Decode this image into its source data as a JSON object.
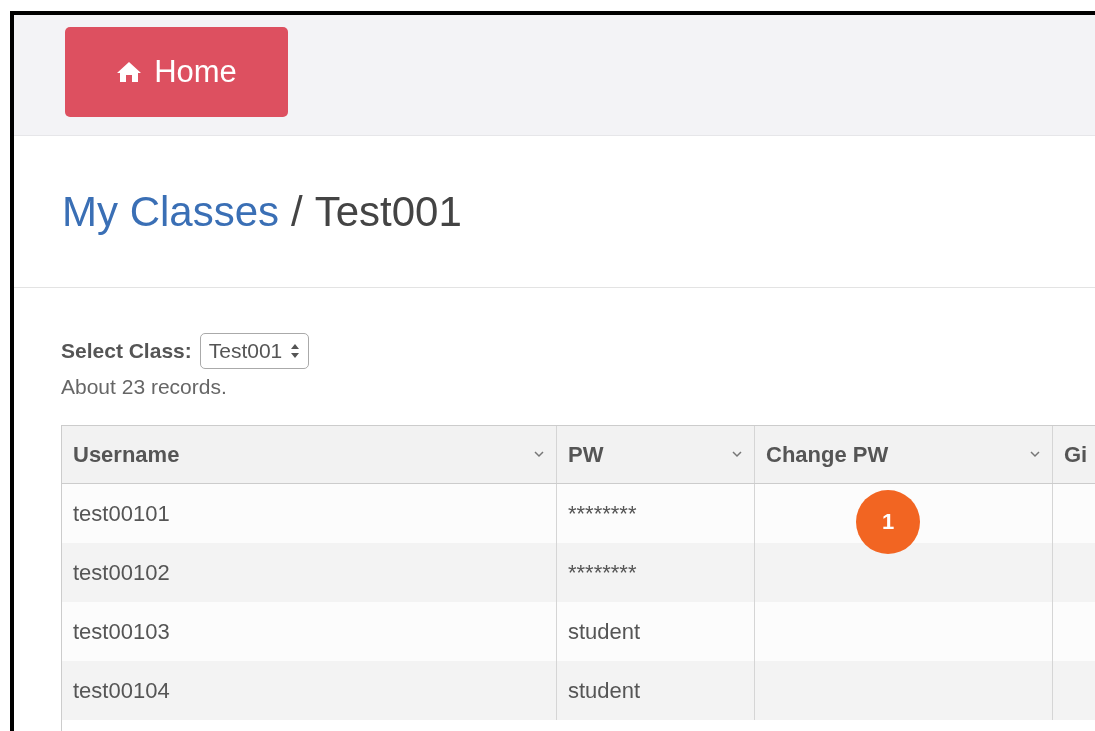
{
  "nav": {
    "home_button": "Home"
  },
  "breadcrumb": {
    "link": "My Classes",
    "separator": "/",
    "current": "Test001"
  },
  "class_select": {
    "label": "Select Class:",
    "value": "Test001"
  },
  "record_count": "About 23 records.",
  "table": {
    "columns": [
      {
        "label": "Username"
      },
      {
        "label": "PW"
      },
      {
        "label": "Change PW"
      },
      {
        "label": "Gi"
      }
    ],
    "rows": [
      {
        "cells": [
          "test00101",
          "********",
          "",
          ""
        ]
      },
      {
        "cells": [
          "test00102",
          "********",
          "",
          ""
        ]
      },
      {
        "cells": [
          "test00103",
          "student",
          "",
          ""
        ]
      },
      {
        "cells": [
          "test00104",
          "student",
          "",
          ""
        ]
      }
    ]
  },
  "callout": {
    "label": "1"
  }
}
